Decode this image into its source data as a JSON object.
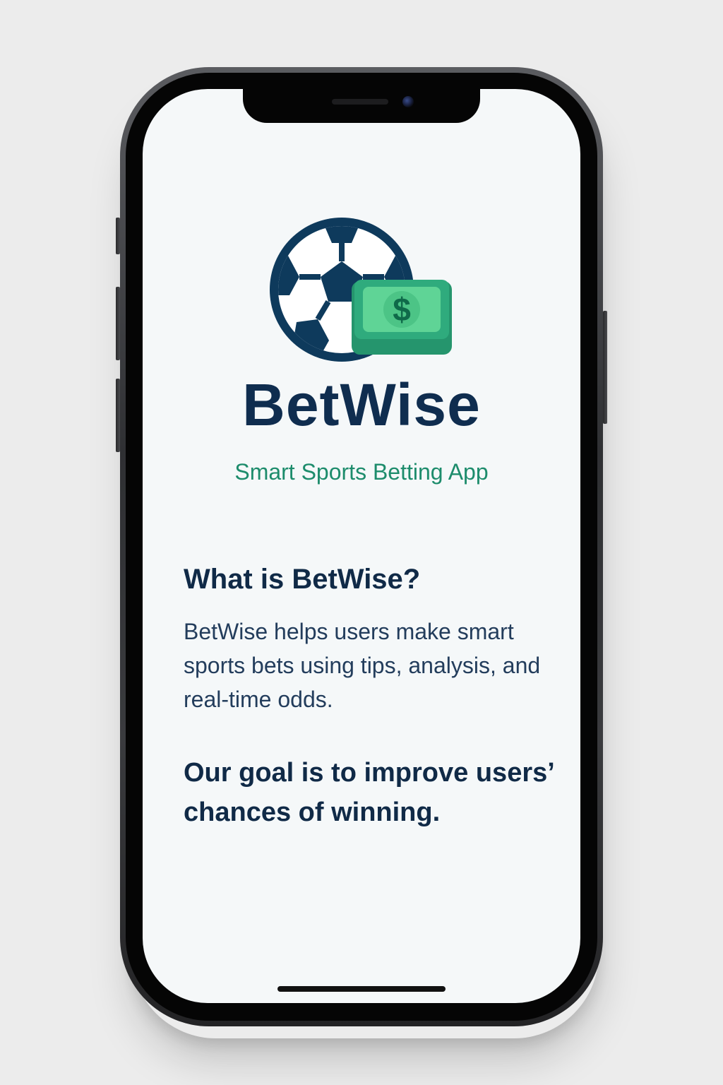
{
  "app": {
    "name": "BetWise",
    "tagline": "Smart Sports Betting App"
  },
  "logo": {
    "icon_ball": "soccer-ball-icon",
    "icon_money": "dollar-bill-icon",
    "money_symbol": "$",
    "colors": {
      "ball_dark": "#0e3a5c",
      "bill_green": "#2fab7d",
      "bill_light": "#5fd496"
    }
  },
  "about": {
    "heading": "What is BetWise?",
    "body": "BetWise helps users make smart sports bets using tips, analysis, and real-time odds.",
    "goal": "Our goal is to improve users’ chances of winning."
  },
  "colors": {
    "title": "#0f2d4f",
    "accent": "#1d8c6c",
    "body_text": "#233d5c",
    "screen_bg": "#f5f8f9"
  }
}
